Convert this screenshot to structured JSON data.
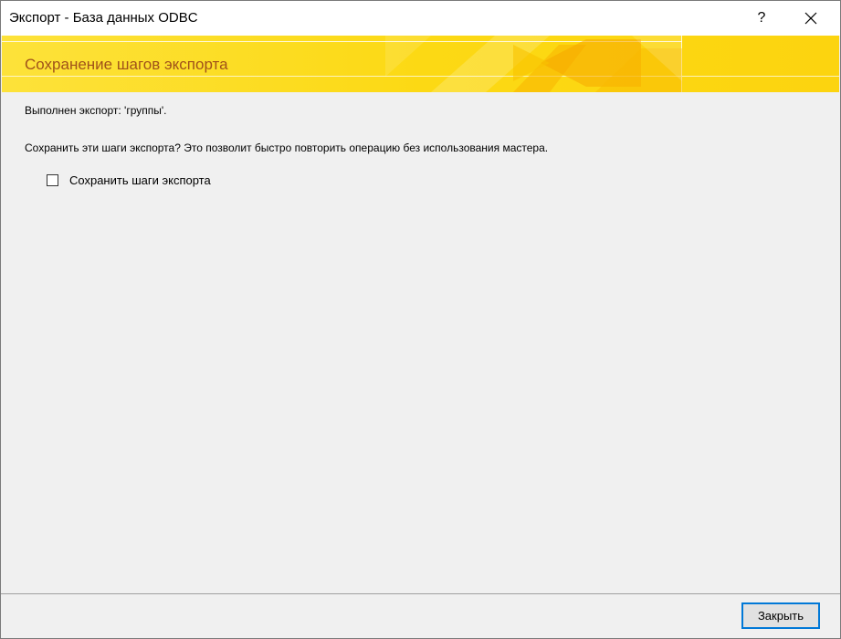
{
  "window": {
    "title": "Экспорт - База данных ODBC",
    "help_label": "?",
    "close_icon": "close-icon"
  },
  "banner": {
    "title": "Сохранение шагов экспорта",
    "colors": {
      "base": "#fcd914",
      "accent": "#f5a800",
      "title_color": "#a0521a"
    }
  },
  "content": {
    "status": "Выполнен экспорт: 'группы'.",
    "question": "Сохранить эти шаги экспорта? Это позволит быстро повторить операцию без использования мастера.",
    "save_steps_checkbox": {
      "label": "Сохранить шаги экспорта",
      "checked": false
    }
  },
  "footer": {
    "close_button_label": "Закрыть",
    "accent": "#0078d7"
  }
}
